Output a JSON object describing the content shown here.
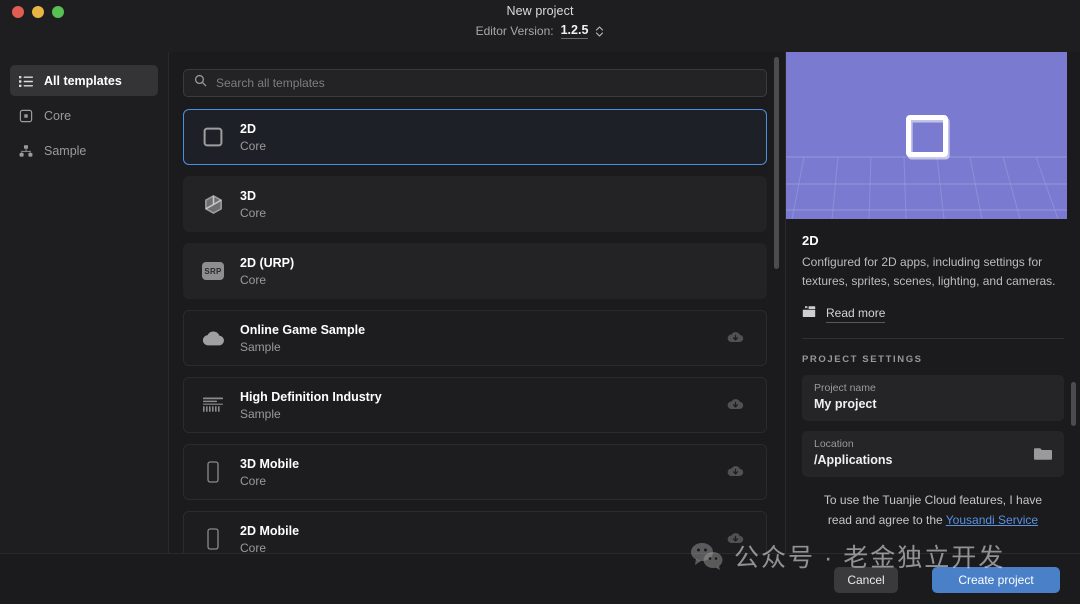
{
  "window": {
    "title": "New project",
    "version_label": "Editor Version:",
    "version_value": "1.2.5"
  },
  "sidebar": {
    "items": [
      {
        "label": "All templates",
        "icon": "list-icon",
        "active": true
      },
      {
        "label": "Core",
        "icon": "core-square-icon",
        "active": false
      },
      {
        "label": "Sample",
        "icon": "sample-nodes-icon",
        "active": false
      }
    ]
  },
  "search": {
    "placeholder": "Search all templates",
    "value": "",
    "icon": "search-icon"
  },
  "templates": [
    {
      "name": "2D",
      "category": "Core",
      "icon": "square-outline-icon",
      "selected": true,
      "downloadable": false
    },
    {
      "name": "3D",
      "category": "Core",
      "icon": "cube-icon",
      "selected": false,
      "downloadable": false
    },
    {
      "name": "2D (URP)",
      "category": "Core",
      "icon": "srp-badge-icon",
      "selected": false,
      "downloadable": false
    },
    {
      "name": "Online Game Sample",
      "category": "Sample",
      "icon": "cloud-icon",
      "selected": false,
      "downloadable": true
    },
    {
      "name": "High Definition Industry",
      "category": "Sample",
      "icon": "hd-lines-icon",
      "selected": false,
      "downloadable": true
    },
    {
      "name": "3D Mobile",
      "category": "Core",
      "icon": "phone-icon",
      "selected": false,
      "downloadable": true
    },
    {
      "name": "2D Mobile",
      "category": "Core",
      "icon": "phone-icon",
      "selected": false,
      "downloadable": true
    }
  ],
  "details": {
    "title": "2D",
    "description": "Configured for 2D apps, including settings for textures, sprites, scenes, lighting, and cameras.",
    "read_more": "Read more",
    "read_more_icon": "book-icon",
    "preview_bg_color": "#7a7bd0"
  },
  "project_settings": {
    "section_label": "PROJECT SETTINGS",
    "project_name_label": "Project name",
    "project_name_value": "My project",
    "location_label": "Location",
    "location_value": "/Applications",
    "folder_icon": "folder-icon"
  },
  "terms": {
    "line1": "To use the Tuanjie Cloud features, I have",
    "line2_prefix": "read and agree to the ",
    "link_text": "Yousandi Service",
    "link_color": "#5a90e0"
  },
  "footer": {
    "cancel_label": "Cancel",
    "create_label": "Create project",
    "create_color": "#4a80c8"
  },
  "watermark": {
    "text": "公众号 · 老金独立开发",
    "icon": "wechat-icon"
  }
}
